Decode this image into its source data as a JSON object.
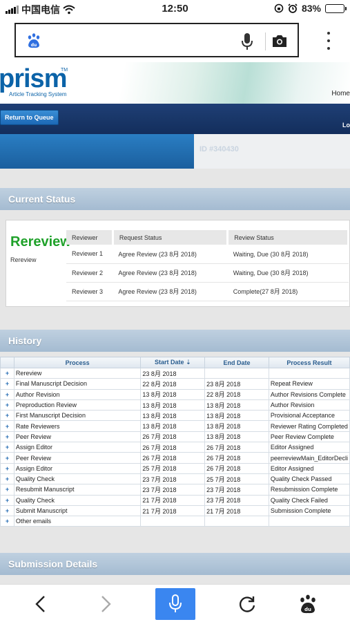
{
  "status_bar": {
    "carrier": "中国电信",
    "time": "12:50",
    "battery": "83%",
    "battery_level": 0.83
  },
  "prism": {
    "logo": "prism",
    "tm": "TM",
    "subtitle": "Article Tracking System",
    "nav_home": "Home"
  },
  "navbar": {
    "return_label": "Return to Queue",
    "right_text": "Lo"
  },
  "manuscript": {
    "id_label": "ID #340430"
  },
  "current_status": {
    "heading": "Current Status",
    "status_title": "Rereview",
    "status_sub": "Rereview",
    "columns": [
      "Reviewer",
      "Request Status",
      "Review Status"
    ],
    "rows": [
      [
        "Reviewer 1",
        "Agree Review (23 8月 2018)",
        "Waiting, Due (30 8月 2018)"
      ],
      [
        "Reviewer 2",
        "Agree Review (23 8月 2018)",
        "Waiting, Due (30 8月 2018)"
      ],
      [
        "Reviewer 3",
        "Agree Review (23 8月 2018)",
        "Complete(27 8月 2018)"
      ]
    ]
  },
  "history": {
    "heading": "History",
    "columns": [
      "",
      "Process",
      "Start Date ⇣",
      "End Date",
      "Process Result"
    ],
    "rows": [
      [
        "+",
        "Rereview",
        "23 8月 2018",
        "",
        ""
      ],
      [
        "+",
        "Final Manuscript Decision",
        "22 8月 2018",
        "23 8月 2018",
        "Repeat Review"
      ],
      [
        "+",
        "Author Revision",
        "13 8月 2018",
        "22 8月 2018",
        "Author Revisions Complete"
      ],
      [
        "+",
        "Preproduction Review",
        "13 8月 2018",
        "13 8月 2018",
        "Author Revision"
      ],
      [
        "+",
        "First Manuscript Decision",
        "13 8月 2018",
        "13 8月 2018",
        "Provisional Acceptance"
      ],
      [
        "+",
        "Rate Reviewers",
        "13 8月 2018",
        "13 8月 2018",
        "Reviewer Rating Completed"
      ],
      [
        "+",
        "Peer Review",
        "26 7月 2018",
        "13 8月 2018",
        "Peer Review Complete"
      ],
      [
        "+",
        "Assign Editor",
        "26 7月 2018",
        "26 7月 2018",
        "Editor Assigned"
      ],
      [
        "+",
        "Peer Review",
        "26 7月 2018",
        "26 7月 2018",
        "peerreviewMain_EditorDecli"
      ],
      [
        "+",
        "Assign Editor",
        "25 7月 2018",
        "26 7月 2018",
        "Editor Assigned"
      ],
      [
        "+",
        "Quality Check",
        "23 7月 2018",
        "25 7月 2018",
        "Quality Check Passed"
      ],
      [
        "+",
        "Resubmit Manuscript",
        "23 7月 2018",
        "23 7月 2018",
        "Resubmission Complete"
      ],
      [
        "+",
        "Quality Check",
        "21 7月 2018",
        "23 7月 2018",
        "Quality Check Failed"
      ],
      [
        "+",
        "Submit Manuscript",
        "21 7月 2018",
        "21 7月 2018",
        "Submission Complete"
      ],
      [
        "+",
        "Other emails",
        "",
        "",
        ""
      ]
    ]
  },
  "submission": {
    "heading": "Submission Details"
  },
  "icons": {
    "search_logo": "baidu-paw-icon",
    "mic": "microphone-icon",
    "camera": "camera-icon",
    "more": "more-vertical-icon"
  },
  "colors": {
    "accent": "#3a86f0",
    "brand": "#0b63a8",
    "status_green": "#1fa12a",
    "navbar": "#1f3f75"
  }
}
